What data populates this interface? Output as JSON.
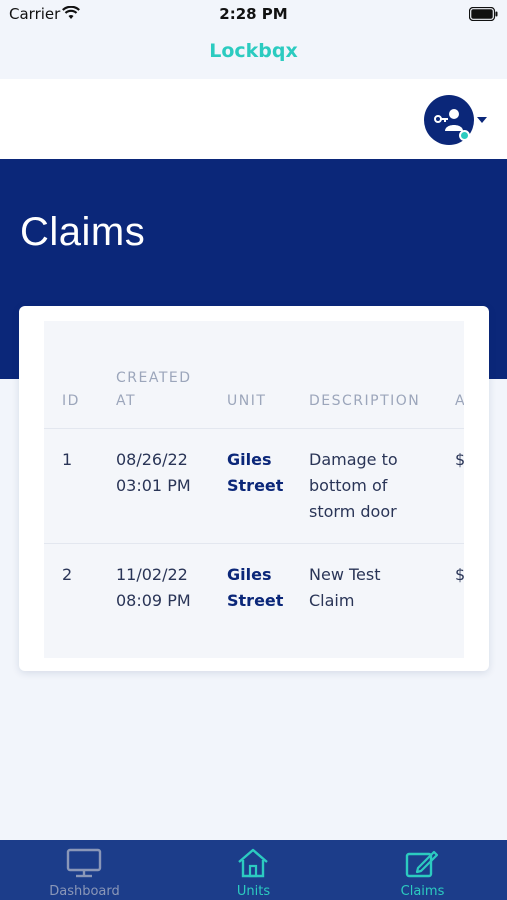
{
  "status_bar": {
    "carrier": "Carrier",
    "time": "2:28 PM"
  },
  "app": {
    "title": "Lockbqx"
  },
  "page": {
    "title": "Claims"
  },
  "table": {
    "columns": [
      "ID",
      "CREATED AT",
      "UNIT",
      "DESCRIPTION",
      "A"
    ],
    "rows": [
      {
        "id": "1",
        "created_date": "08/26/22",
        "created_time": "03:01 PM",
        "unit_line1": "Giles",
        "unit_line2": "Street",
        "desc_line1": "Damage to",
        "desc_line2": "bottom of",
        "desc_line3": "storm door",
        "amount_partial": "$"
      },
      {
        "id": "2",
        "created_date": "11/02/22",
        "created_time": "08:09 PM",
        "unit_line1": "Giles",
        "unit_line2": "Street",
        "desc_line1": "New Test",
        "desc_line2": "Claim",
        "desc_line3": "",
        "amount_partial": "$"
      }
    ]
  },
  "tabs": [
    {
      "label": "Dashboard",
      "icon": "monitor-icon",
      "active": false
    },
    {
      "label": "Units",
      "icon": "home-icon",
      "active": true
    },
    {
      "label": "Claims",
      "icon": "claims-edit-icon",
      "active": true
    }
  ],
  "colors": {
    "navy": "#0b2779",
    "teal": "#2ccbc0",
    "tabbar": "#1c3d8a",
    "inactive": "#8a97b8"
  }
}
